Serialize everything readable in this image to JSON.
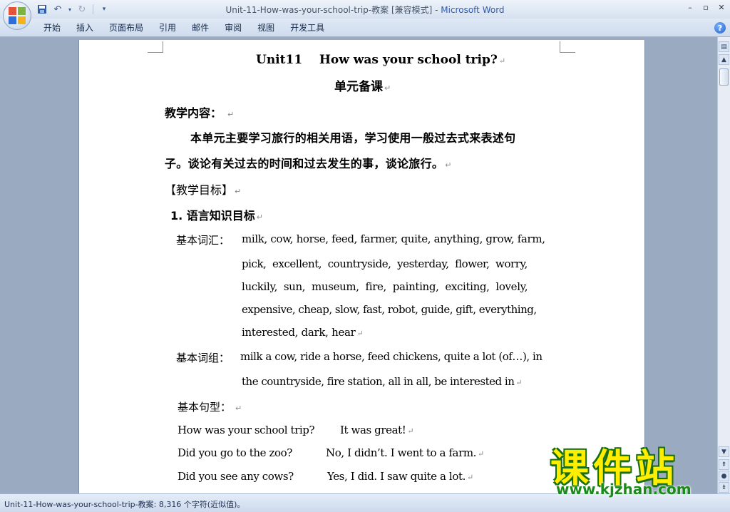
{
  "window": {
    "title": "Unit-11-How-was-your-school-trip-教案 [兼容模式] - ",
    "title_brand": "Microsoft Word"
  },
  "ribbon": {
    "tabs": [
      "开始",
      "插入",
      "页面布局",
      "引用",
      "邮件",
      "审阅",
      "视图",
      "开发工具"
    ]
  },
  "document": {
    "title": "Unit11    How was your school trip?",
    "subtitle": "单元备课",
    "section1_heading": "教学内容：",
    "content_line1": "本单元主要学习旅行的相关用语，学习使用一般过去式来表述句",
    "content_line2": "子。谈论有关过去的时间和过去发生的事，谈论旅行。",
    "goals_heading": "【教学目标】",
    "goal1_heading": "1. 语言知识目标",
    "vocab_label": "基本词汇：",
    "vocab_line1": "milk, cow, horse, feed, farmer, quite, anything, grow, farm,",
    "vocab_line2": "pick,  excellent,  countryside,  yesterday,  flower,  worry,",
    "vocab_line3": "luckily,  sun,  museum,  fire,  painting,  exciting,  lovely,",
    "vocab_line4": "expensive, cheap, slow, fast, robot, guide, gift, everything,",
    "vocab_line5": "interested, dark, hear",
    "phrases_label": "基本词组：",
    "phrases_line1": "milk a cow, ride a horse, feed chickens, quite a lot (of…), in",
    "phrases_line2": "the countryside, fire station, all in all, be interested in",
    "sentences_label": "基本句型：",
    "sentences": [
      {
        "q": "How was your school trip?",
        "a": "It was great!"
      },
      {
        "q": "Did you go to the zoo?",
        "a": "No, I didn’t. I went to a farm."
      },
      {
        "q": "Did you see any cows?",
        "a": "Yes, I did. I saw quite a lot."
      }
    ],
    "paragraph_mark": "↵"
  },
  "statusbar": {
    "text": "Unit-11-How-was-your-school-trip-教案: 8,316 个字符(近似值)。"
  },
  "watermark": {
    "cn": "课件站",
    "url": "www.kjzhan.com"
  }
}
